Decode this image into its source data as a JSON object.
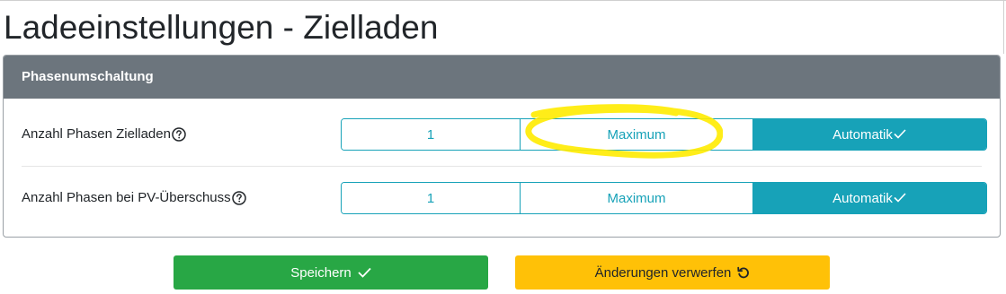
{
  "page": {
    "title": "Ladeeinstellungen - Zielladen"
  },
  "card": {
    "header": "Phasenumschaltung",
    "rows": [
      {
        "label": "Anzahl Phasen Zielladen",
        "options": [
          "1",
          "Maximum",
          "Automatik"
        ],
        "selected": "Automatik"
      },
      {
        "label": "Anzahl Phasen bei PV-Überschuss",
        "options": [
          "1",
          "Maximum",
          "Automatik"
        ],
        "selected": "Automatik"
      }
    ]
  },
  "buttons": {
    "save": "Speichern",
    "discard": "Änderungen verwerfen"
  },
  "icons": {
    "help": "help-circle-icon",
    "check": "check-icon",
    "undo": "undo-icon"
  },
  "colors": {
    "header_bg": "#6c757d",
    "accent": "#17a2b8",
    "save": "#28a745",
    "discard": "#ffc107",
    "highlight": "#ffeb00"
  }
}
